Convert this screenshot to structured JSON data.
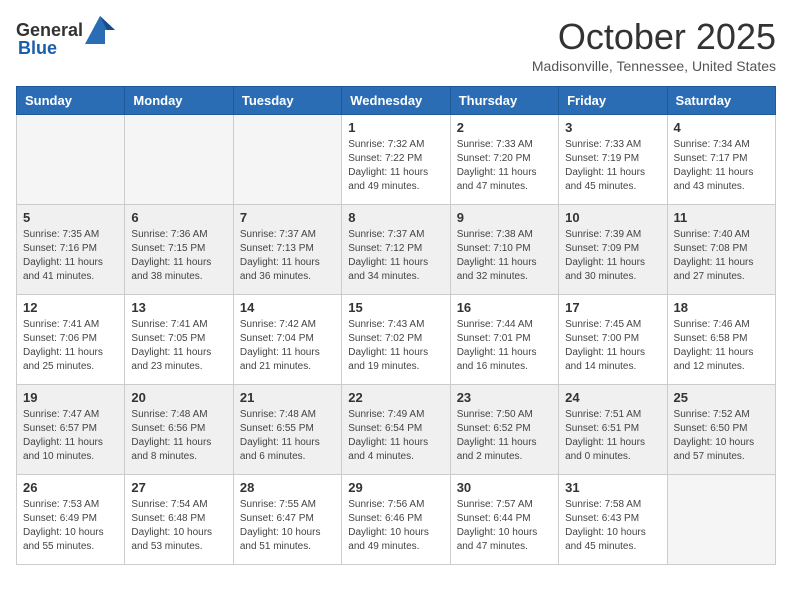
{
  "logo": {
    "general": "General",
    "blue": "Blue"
  },
  "header": {
    "month": "October 2025",
    "location": "Madisonville, Tennessee, United States"
  },
  "weekdays": [
    "Sunday",
    "Monday",
    "Tuesday",
    "Wednesday",
    "Thursday",
    "Friday",
    "Saturday"
  ],
  "weeks": [
    {
      "shaded": false,
      "days": [
        {
          "num": "",
          "info": ""
        },
        {
          "num": "",
          "info": ""
        },
        {
          "num": "",
          "info": ""
        },
        {
          "num": "1",
          "info": "Sunrise: 7:32 AM\nSunset: 7:22 PM\nDaylight: 11 hours and 49 minutes."
        },
        {
          "num": "2",
          "info": "Sunrise: 7:33 AM\nSunset: 7:20 PM\nDaylight: 11 hours and 47 minutes."
        },
        {
          "num": "3",
          "info": "Sunrise: 7:33 AM\nSunset: 7:19 PM\nDaylight: 11 hours and 45 minutes."
        },
        {
          "num": "4",
          "info": "Sunrise: 7:34 AM\nSunset: 7:17 PM\nDaylight: 11 hours and 43 minutes."
        }
      ]
    },
    {
      "shaded": true,
      "days": [
        {
          "num": "5",
          "info": "Sunrise: 7:35 AM\nSunset: 7:16 PM\nDaylight: 11 hours and 41 minutes."
        },
        {
          "num": "6",
          "info": "Sunrise: 7:36 AM\nSunset: 7:15 PM\nDaylight: 11 hours and 38 minutes."
        },
        {
          "num": "7",
          "info": "Sunrise: 7:37 AM\nSunset: 7:13 PM\nDaylight: 11 hours and 36 minutes."
        },
        {
          "num": "8",
          "info": "Sunrise: 7:37 AM\nSunset: 7:12 PM\nDaylight: 11 hours and 34 minutes."
        },
        {
          "num": "9",
          "info": "Sunrise: 7:38 AM\nSunset: 7:10 PM\nDaylight: 11 hours and 32 minutes."
        },
        {
          "num": "10",
          "info": "Sunrise: 7:39 AM\nSunset: 7:09 PM\nDaylight: 11 hours and 30 minutes."
        },
        {
          "num": "11",
          "info": "Sunrise: 7:40 AM\nSunset: 7:08 PM\nDaylight: 11 hours and 27 minutes."
        }
      ]
    },
    {
      "shaded": false,
      "days": [
        {
          "num": "12",
          "info": "Sunrise: 7:41 AM\nSunset: 7:06 PM\nDaylight: 11 hours and 25 minutes."
        },
        {
          "num": "13",
          "info": "Sunrise: 7:41 AM\nSunset: 7:05 PM\nDaylight: 11 hours and 23 minutes."
        },
        {
          "num": "14",
          "info": "Sunrise: 7:42 AM\nSunset: 7:04 PM\nDaylight: 11 hours and 21 minutes."
        },
        {
          "num": "15",
          "info": "Sunrise: 7:43 AM\nSunset: 7:02 PM\nDaylight: 11 hours and 19 minutes."
        },
        {
          "num": "16",
          "info": "Sunrise: 7:44 AM\nSunset: 7:01 PM\nDaylight: 11 hours and 16 minutes."
        },
        {
          "num": "17",
          "info": "Sunrise: 7:45 AM\nSunset: 7:00 PM\nDaylight: 11 hours and 14 minutes."
        },
        {
          "num": "18",
          "info": "Sunrise: 7:46 AM\nSunset: 6:58 PM\nDaylight: 11 hours and 12 minutes."
        }
      ]
    },
    {
      "shaded": true,
      "days": [
        {
          "num": "19",
          "info": "Sunrise: 7:47 AM\nSunset: 6:57 PM\nDaylight: 11 hours and 10 minutes."
        },
        {
          "num": "20",
          "info": "Sunrise: 7:48 AM\nSunset: 6:56 PM\nDaylight: 11 hours and 8 minutes."
        },
        {
          "num": "21",
          "info": "Sunrise: 7:48 AM\nSunset: 6:55 PM\nDaylight: 11 hours and 6 minutes."
        },
        {
          "num": "22",
          "info": "Sunrise: 7:49 AM\nSunset: 6:54 PM\nDaylight: 11 hours and 4 minutes."
        },
        {
          "num": "23",
          "info": "Sunrise: 7:50 AM\nSunset: 6:52 PM\nDaylight: 11 hours and 2 minutes."
        },
        {
          "num": "24",
          "info": "Sunrise: 7:51 AM\nSunset: 6:51 PM\nDaylight: 11 hours and 0 minutes."
        },
        {
          "num": "25",
          "info": "Sunrise: 7:52 AM\nSunset: 6:50 PM\nDaylight: 10 hours and 57 minutes."
        }
      ]
    },
    {
      "shaded": false,
      "days": [
        {
          "num": "26",
          "info": "Sunrise: 7:53 AM\nSunset: 6:49 PM\nDaylight: 10 hours and 55 minutes."
        },
        {
          "num": "27",
          "info": "Sunrise: 7:54 AM\nSunset: 6:48 PM\nDaylight: 10 hours and 53 minutes."
        },
        {
          "num": "28",
          "info": "Sunrise: 7:55 AM\nSunset: 6:47 PM\nDaylight: 10 hours and 51 minutes."
        },
        {
          "num": "29",
          "info": "Sunrise: 7:56 AM\nSunset: 6:46 PM\nDaylight: 10 hours and 49 minutes."
        },
        {
          "num": "30",
          "info": "Sunrise: 7:57 AM\nSunset: 6:44 PM\nDaylight: 10 hours and 47 minutes."
        },
        {
          "num": "31",
          "info": "Sunrise: 7:58 AM\nSunset: 6:43 PM\nDaylight: 10 hours and 45 minutes."
        },
        {
          "num": "",
          "info": ""
        }
      ]
    }
  ]
}
